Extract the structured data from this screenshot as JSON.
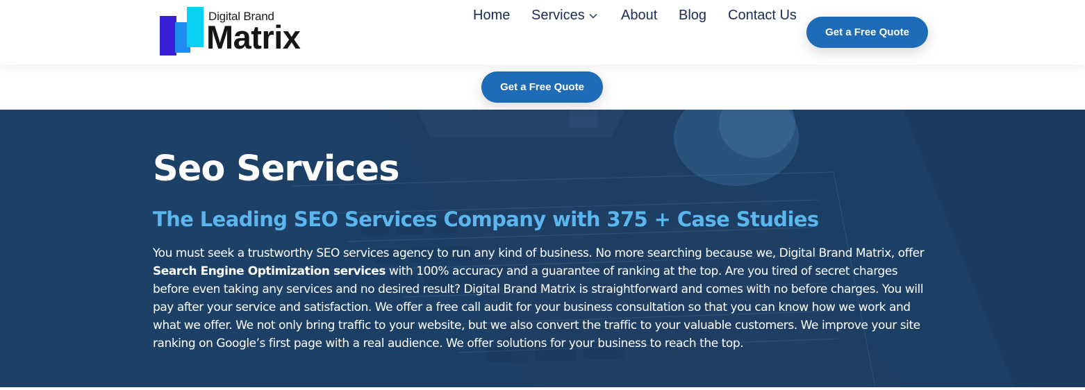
{
  "brand": {
    "name_top": "Digital Brand",
    "name_main": "Matrix",
    "colors": {
      "bar_dark": "#3a1fd8",
      "bar_mid": "#1f8bef",
      "bar_light": "#0ad1f4"
    }
  },
  "nav": {
    "home": "Home",
    "services": "Services",
    "about": "About",
    "blog": "Blog",
    "contact": "Contact Us",
    "services_icon": "chevron-down-icon"
  },
  "cta": {
    "header_label": "Get a Free Quote",
    "secondary_label": "Get a Free Quote",
    "color": "#1e6bb8"
  },
  "hero": {
    "title": "Seo Services",
    "subtitle": "The Leading SEO Services Company with 375 + Case Studies",
    "body_part1": "You must seek a trustworthy SEO services agency to run any kind of business. No more searching because we, Digital Brand Matrix, offer ",
    "body_bold": "Search Engine Optimization services",
    "body_part2": " with 100% accuracy and a guarantee of ranking at the top. Are you tired of secret charges before even taking any services and no desired result? Digital Brand Matrix is straightforward and comes with no before charges. You will pay after your service and satisfaction. We offer a free call audit for your business consultation so that you can know how we work and what we offer. We not only bring traffic to your website, but we also convert the traffic to your valuable customers. We improve your site ranking on Google’s first page with a real audience. We offer solutions for your business to reach the top.",
    "colors": {
      "overlay": "#1c3f65",
      "subtitle": "#5cb6ee"
    }
  }
}
